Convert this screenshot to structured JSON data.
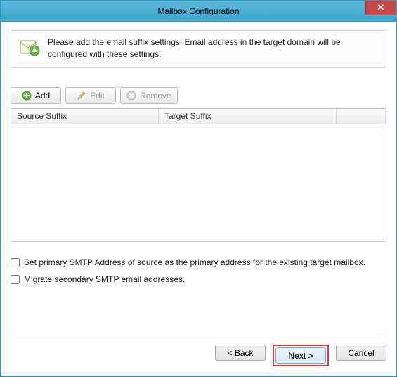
{
  "window": {
    "title": "Mailbox Configuration"
  },
  "info": {
    "text": "Please add the email suffix settings. Email address in the target domain will be configured with these settings."
  },
  "toolbar": {
    "add": "Add",
    "edit": "Edit",
    "remove": "Remove"
  },
  "table": {
    "headers": {
      "source": "Source Suffix",
      "target": "Target Suffix"
    },
    "rows": []
  },
  "options": {
    "primary_smtp": "Set primary SMTP Address of source as the primary address for the existing target mailbox.",
    "migrate_secondary": "Migrate secondary SMTP email addresses."
  },
  "footer": {
    "back": "< Back",
    "next": "Next >",
    "cancel": "Cancel"
  }
}
